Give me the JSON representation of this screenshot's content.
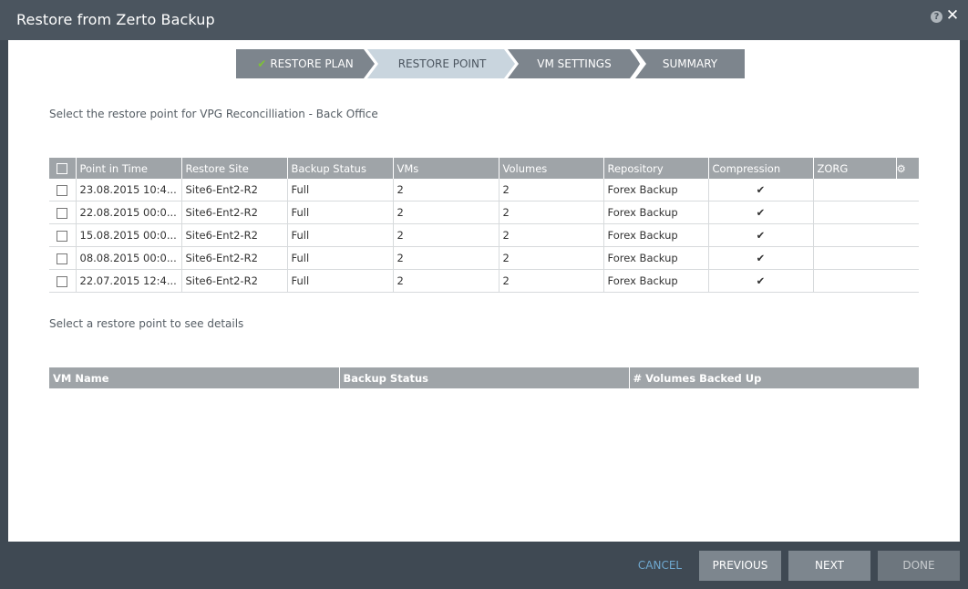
{
  "dialog": {
    "title": "Restore from Zerto Backup",
    "help_glyph": "?",
    "close_glyph": "✕"
  },
  "wizard": {
    "steps": [
      {
        "label": "RESTORE PLAN",
        "state": "completed"
      },
      {
        "label": "RESTORE POINT",
        "state": "active"
      },
      {
        "label": "VM SETTINGS",
        "state": "pending"
      },
      {
        "label": "SUMMARY",
        "state": "pending"
      }
    ],
    "check_glyph": "✔"
  },
  "restore_points": {
    "instruction": "Select the restore point for VPG Reconcilliation - Back Office",
    "columns": [
      "Point in Time",
      "Restore Site",
      "Backup Status",
      "VMs",
      "Volumes",
      "Repository",
      "Compression",
      "ZORG"
    ],
    "gear_glyph": "⚙",
    "check_mark": "✔",
    "rows": [
      {
        "point_in_time": "23.08.2015 10:4...",
        "restore_site": "Site6-Ent2-R2",
        "backup_status": "Full",
        "vms": "2",
        "volumes": "2",
        "repository": "Forex Backup",
        "compression": "✔",
        "zorg": ""
      },
      {
        "point_in_time": "22.08.2015 00:0...",
        "restore_site": "Site6-Ent2-R2",
        "backup_status": "Full",
        "vms": "2",
        "volumes": "2",
        "repository": "Forex Backup",
        "compression": "✔",
        "zorg": ""
      },
      {
        "point_in_time": "15.08.2015 00:0...",
        "restore_site": "Site6-Ent2-R2",
        "backup_status": "Full",
        "vms": "2",
        "volumes": "2",
        "repository": "Forex Backup",
        "compression": "✔",
        "zorg": ""
      },
      {
        "point_in_time": "08.08.2015 00:0...",
        "restore_site": "Site6-Ent2-R2",
        "backup_status": "Full",
        "vms": "2",
        "volumes": "2",
        "repository": "Forex Backup",
        "compression": "✔",
        "zorg": ""
      },
      {
        "point_in_time": "22.07.2015 12:4...",
        "restore_site": "Site6-Ent2-R2",
        "backup_status": "Full",
        "vms": "2",
        "volumes": "2",
        "repository": "Forex Backup",
        "compression": "✔",
        "zorg": ""
      }
    ]
  },
  "details": {
    "instruction": "Select a restore point to see details",
    "columns": [
      "VM Name",
      "Backup Status",
      "# Volumes Backed Up"
    ]
  },
  "footer": {
    "cancel": "CANCEL",
    "previous": "PREVIOUS",
    "next": "NEXT",
    "done": "DONE"
  },
  "colors": {
    "accent_check": "#7ec234",
    "link_blue": "#6fa8cf",
    "active_step": "#c9d5de",
    "inactive_step": "#7d858d"
  }
}
